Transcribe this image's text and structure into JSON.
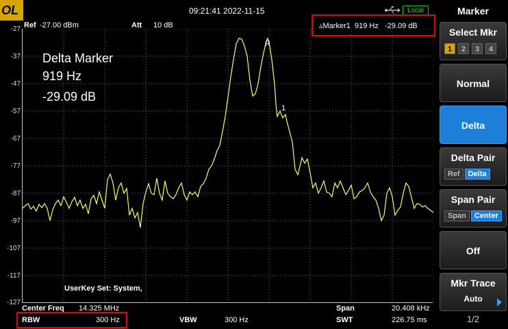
{
  "top": {
    "logo": "OL",
    "datetime": "09:21:41 2022-11-15",
    "local": "Local"
  },
  "header": {
    "ref_label": "Ref",
    "ref_value": "-27.00 dBm",
    "att_label": "Att",
    "att_value": "10 dB",
    "marker_readout": "▵Marker1  919 Hz   -29.09 dB"
  },
  "y_axis": [
    "-27",
    "-37",
    "-47",
    "-57",
    "-67",
    "-77",
    "-87",
    "-97",
    "-107",
    "-117",
    "-127"
  ],
  "overlay": {
    "line1": "Delta Marker",
    "line2": "919 Hz",
    "line3": "-29.09 dB",
    "userkey": "UserKey Set:   System,"
  },
  "markers": {
    "ref": "R",
    "m1": "1"
  },
  "bottom": {
    "center_label": "Center Freq",
    "center_value": "14.325 MHz",
    "span_label": "Span",
    "span_value": "20.408 kHz",
    "rbw_label": "RBW",
    "rbw_value": "300 Hz",
    "vbw_label": "VBW",
    "vbw_value": "300 Hz",
    "swt_label": "SWT",
    "swt_value": "226.75 ms"
  },
  "menu": {
    "title": "Marker",
    "select_mkr": "Select Mkr",
    "mkr_numbers": [
      "1",
      "2",
      "3",
      "4"
    ],
    "normal": "Normal",
    "delta": "Delta",
    "delta_pair": "Delta Pair",
    "delta_pair_opts": [
      "Ref",
      "Delta"
    ],
    "span_pair": "Span Pair",
    "span_pair_opts": [
      "Span",
      "Center"
    ],
    "off": "Off",
    "mkr_trace": "Mkr Trace",
    "mkr_trace_val": "Auto",
    "page": "1/2"
  },
  "colors": {
    "trace": "#ffff55",
    "accent": "#1e7fd8",
    "highlight": "#e00000",
    "logo": "#d8a400"
  },
  "icons": [
    "usb-icon"
  ]
}
